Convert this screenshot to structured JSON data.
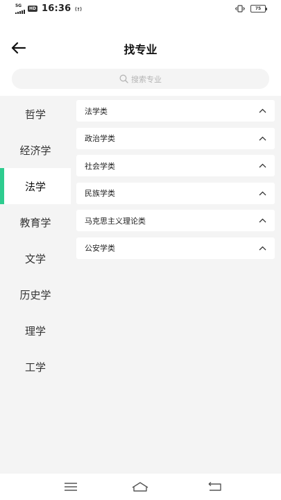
{
  "status_bar": {
    "network": "5G",
    "hd_badge": "HD",
    "time": "16:36",
    "battery_level": "75"
  },
  "header": {
    "title": "找专业"
  },
  "search": {
    "placeholder": "搜索专业"
  },
  "sidebar": {
    "items": [
      {
        "label": "哲学"
      },
      {
        "label": "经济学"
      },
      {
        "label": "法学"
      },
      {
        "label": "教育学"
      },
      {
        "label": "文学"
      },
      {
        "label": "历史学"
      },
      {
        "label": "理学"
      },
      {
        "label": "工学"
      }
    ],
    "active_index": 2
  },
  "categories": {
    "items": [
      {
        "label": "法学类"
      },
      {
        "label": "政治学类"
      },
      {
        "label": "社会学类"
      },
      {
        "label": "民族学类"
      },
      {
        "label": "马克思主义理论类"
      },
      {
        "label": "公安学类"
      }
    ]
  },
  "colors": {
    "accent": "#2ecc8f",
    "panel_bg": "#f4f4f4"
  },
  "icons": {
    "back": "arrow-left-icon",
    "search": "search-icon",
    "expand": "chevron-up-icon",
    "nav_menu": "menu-icon",
    "nav_home": "home-icon",
    "nav_back": "return-icon"
  }
}
